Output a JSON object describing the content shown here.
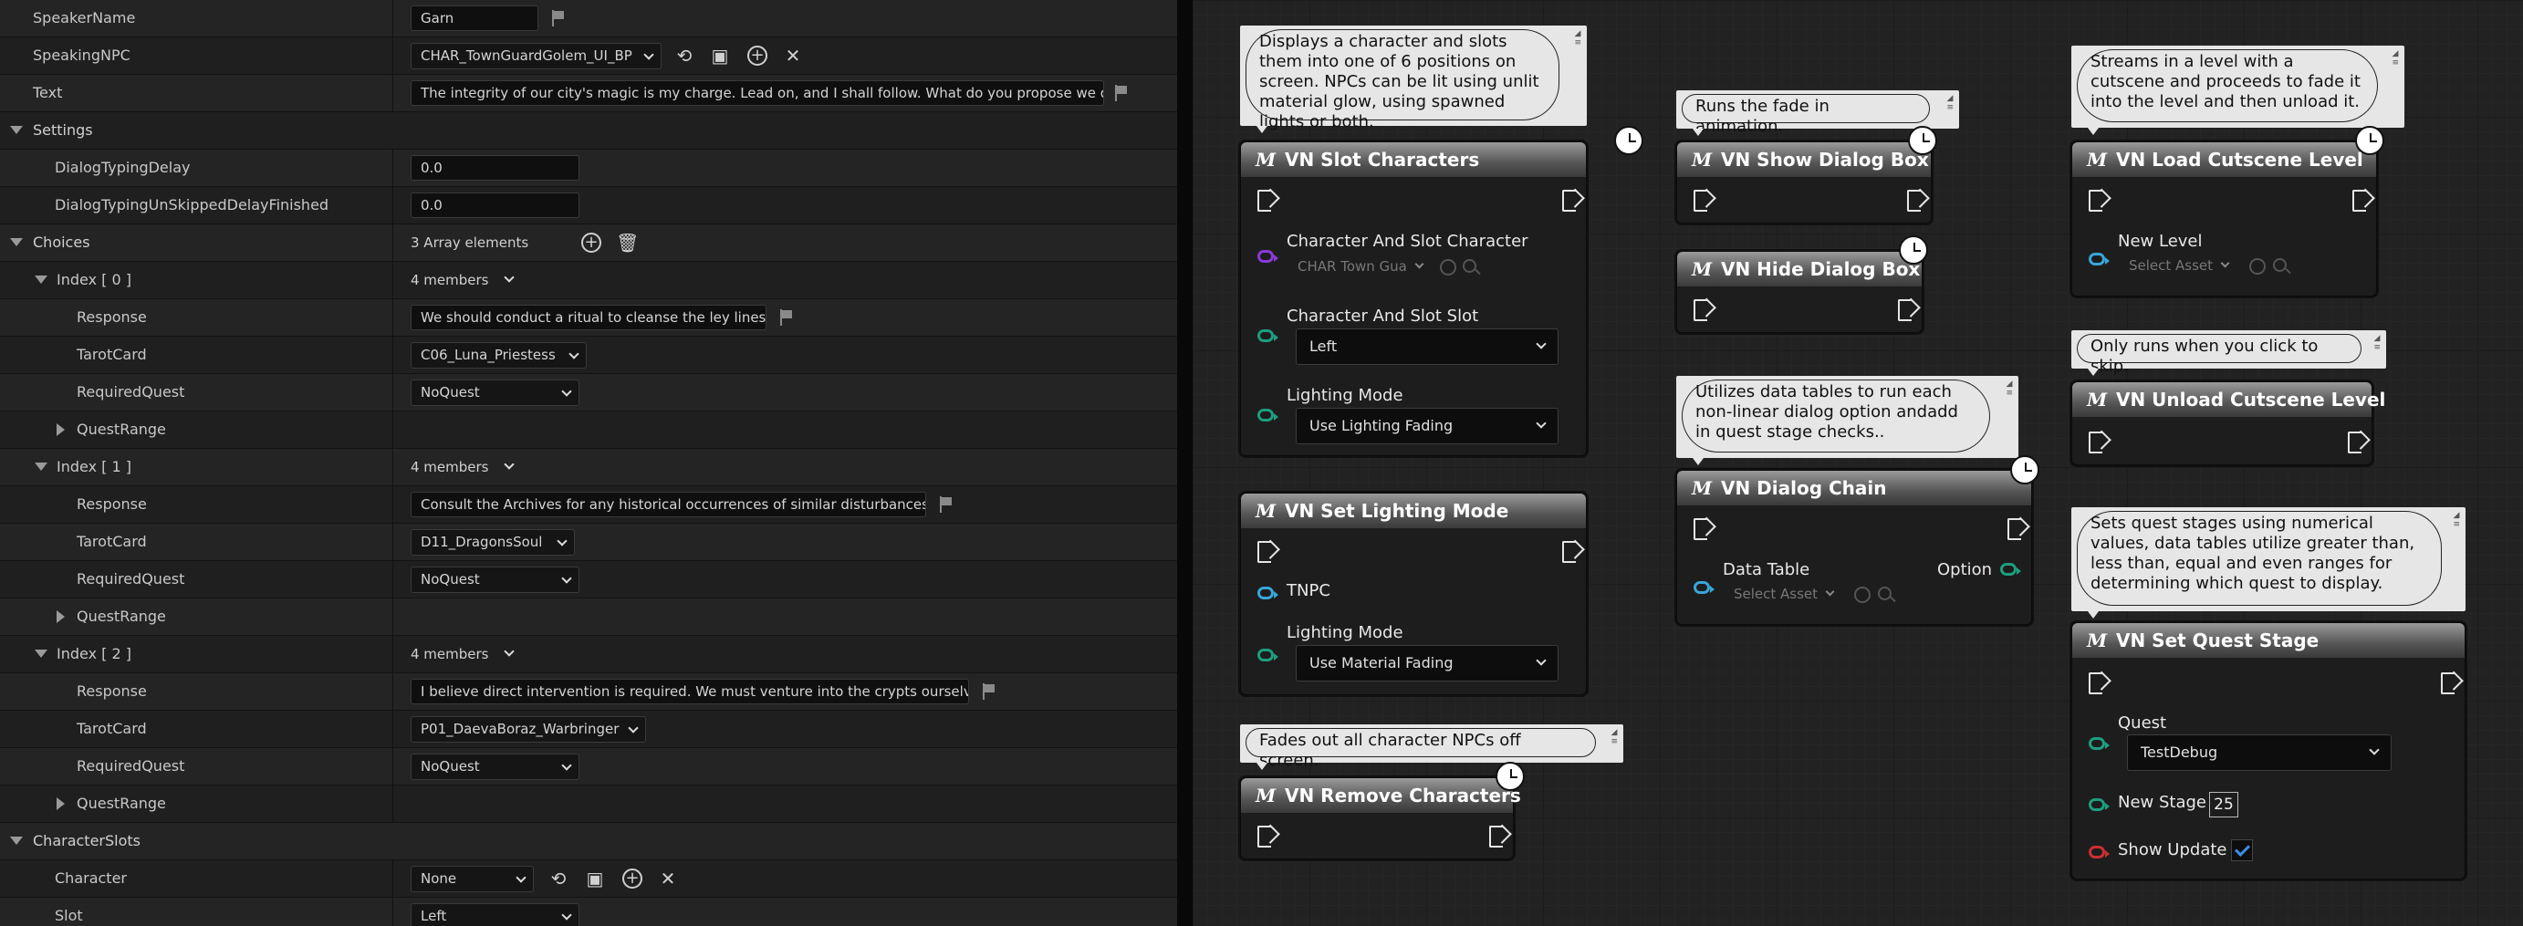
{
  "details": {
    "speaker_name": {
      "label": "SpeakerName",
      "value": "Garn"
    },
    "speaking_npc": {
      "label": "SpeakingNPC",
      "value": "CHAR_TownGuardGolem_UI_BP"
    },
    "text": {
      "label": "Text",
      "value": "The integrity of our city's magic is my charge. Lead on, and I shall follow. What do you propose we do?"
    },
    "settings": {
      "label": "Settings",
      "typing_delay": {
        "label": "DialogTypingDelay",
        "value": "0.0"
      },
      "typing_unskipped": {
        "label": "DialogTypingUnSkippedDelayFinished",
        "value": "0.0"
      }
    },
    "choices": {
      "label": "Choices",
      "summary": "3 Array elements",
      "items": [
        {
          "index": "Index [ 0 ]",
          "members": "4 members",
          "response_label": "Response",
          "response": "We should conduct a ritual to cleanse the ley lines.",
          "tarot_label": "TarotCard",
          "tarot": "C06_Luna_Priestess",
          "quest_label": "RequiredQuest",
          "quest": "NoQuest",
          "range_label": "QuestRange"
        },
        {
          "index": "Index [ 1 ]",
          "members": "4 members",
          "response_label": "Response",
          "response": "Consult the Archives for any historical occurrences of similar disturbances.",
          "tarot_label": "TarotCard",
          "tarot": "D11_DragonsSoul",
          "quest_label": "RequiredQuest",
          "quest": "NoQuest",
          "range_label": "QuestRange"
        },
        {
          "index": "Index [ 2 ]",
          "members": "4 members",
          "response_label": "Response",
          "response": "I believe direct intervention is required. We must venture into the crypts ourselves.",
          "tarot_label": "TarotCard",
          "tarot": "P01_DaevaBoraz_Warbringer",
          "quest_label": "RequiredQuest",
          "quest": "NoQuest",
          "range_label": "QuestRange"
        }
      ]
    },
    "character_slots": {
      "label": "CharacterSlots",
      "character": {
        "label": "Character",
        "value": "None"
      },
      "slot": {
        "label": "Slot",
        "value": "Left"
      }
    }
  },
  "graph": {
    "comments": {
      "slot_chars": "Displays a character and slots them into one of 6 positions on screen. NPCs can be lit using unlit material glow, using spawned lights or both.",
      "show_dialog": "Runs the fade in animation.",
      "dialog_chain": "Utilizes data tables to run each non-linear dialog option andadd in quest stage checks..",
      "remove_chars": "Fades out all character NPCs off screen.",
      "load_cutscene": "Streams in a level with a cutscene and proceeds to fade it into the level and then unload it.",
      "unload_cutscene": "Only runs when you click to skip.",
      "quest_stage": "Sets quest stages using numerical values, data tables utilize greater than, less than, equal and even ranges for determining which quest to display."
    },
    "macro_glyph": "M",
    "nodes": {
      "slot_characters": {
        "title": "VN Slot Characters",
        "pin1": "Character And Slot Character",
        "pin1_value": "CHAR Town Gua",
        "pin2": "Character And Slot Slot",
        "pin2_value": "Left",
        "pin3": "Lighting Mode",
        "pin3_value": "Use Lighting Fading"
      },
      "set_lighting": {
        "title": "VN Set Lighting Mode",
        "pin1": "TNPC",
        "pin2": "Lighting Mode",
        "pin2_value": "Use Material Fading"
      },
      "remove_chars": {
        "title": "VN Remove Characters"
      },
      "show_dialog": {
        "title": "VN Show Dialog Box"
      },
      "hide_dialog": {
        "title": "VN Hide Dialog Box"
      },
      "dialog_chain": {
        "title": "VN Dialog Chain",
        "pin1": "Data Table",
        "pin1_value": "Select Asset",
        "out": "Option"
      },
      "load_cutscene": {
        "title": "VN Load Cutscene Level",
        "pin1": "New Level",
        "pin1_value": "Select Asset"
      },
      "unload_cutscene": {
        "title": "VN Unload Cutscene Level"
      },
      "quest_stage": {
        "title": "VN Set Quest Stage",
        "pin1": "Quest",
        "pin1_value": "TestDebug",
        "pin2": "New Stage",
        "pin2_value": "25",
        "pin3": "Show Update",
        "pin3_checked": true
      }
    }
  }
}
